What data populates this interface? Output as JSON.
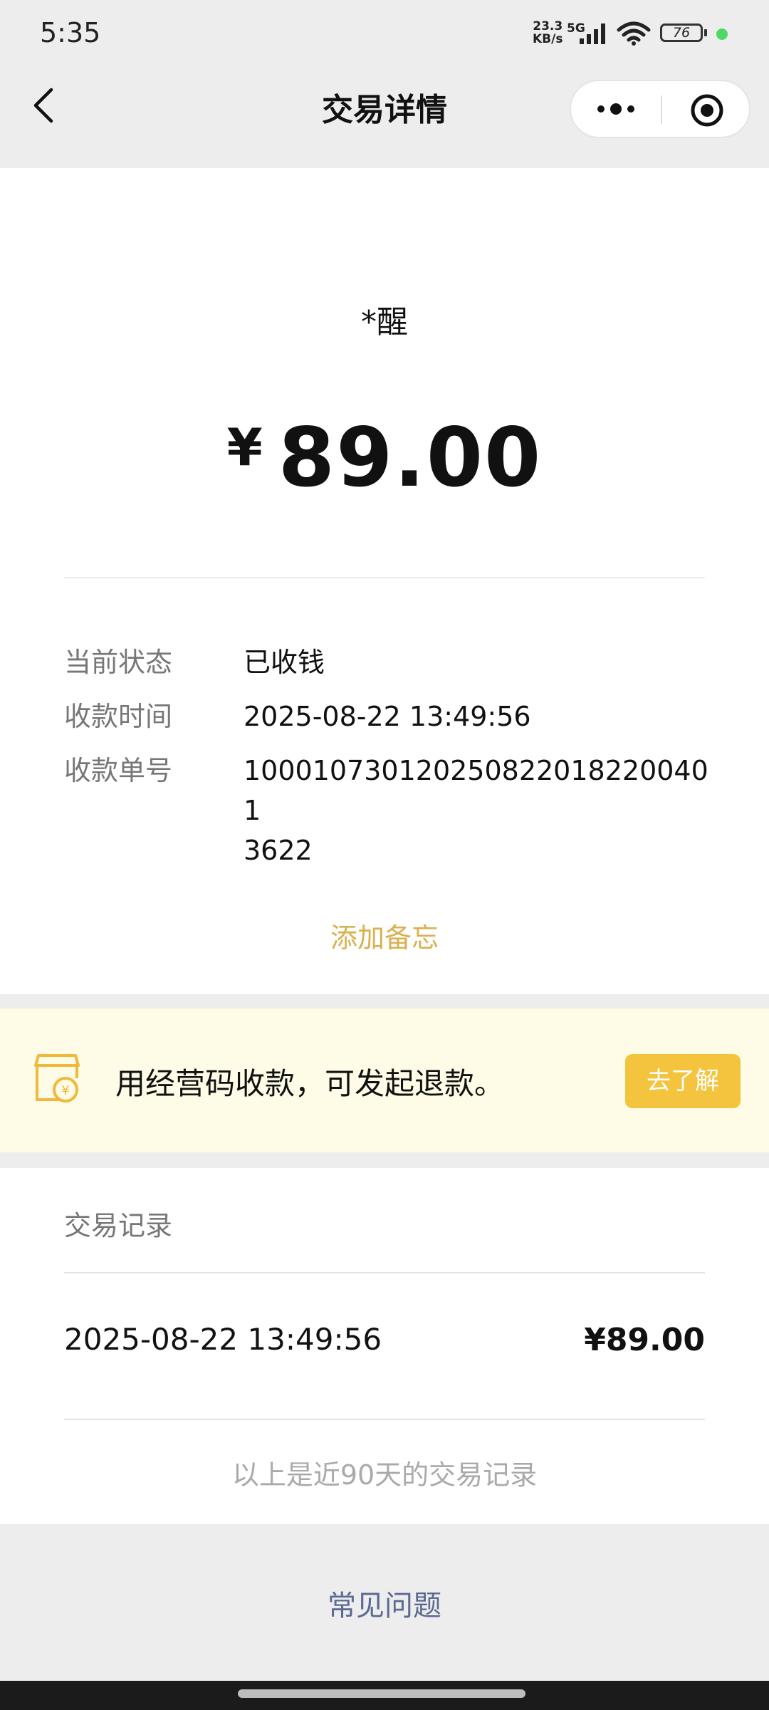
{
  "status_bar": {
    "time": "5:35",
    "net_speed_top": "23.3",
    "net_speed_bottom": "KB/s",
    "network": "5G",
    "battery": "76"
  },
  "nav": {
    "title": "交易详情"
  },
  "transaction": {
    "payer": "*醒",
    "currency_symbol": "¥",
    "amount": "89.00",
    "details": [
      {
        "label": "当前状态",
        "value": "已收钱"
      },
      {
        "label": "收款时间",
        "value": "2025-08-22 13:49:56"
      },
      {
        "label": "收款单号",
        "value": "100010730120250822018220040 13622"
      }
    ],
    "order_number_line1": "100010730120250822018220040 1",
    "order_number_line2": "3622",
    "add_memo": "添加备忘"
  },
  "banner": {
    "text": "用经营码收款，可发起退款。",
    "button": "去了解"
  },
  "records": {
    "title": "交易记录",
    "items": [
      {
        "time": "2025-08-22 13:49:56",
        "amount": "¥89.00"
      }
    ],
    "note": "以上是近90天的交易记录"
  },
  "faq": "常见问题"
}
